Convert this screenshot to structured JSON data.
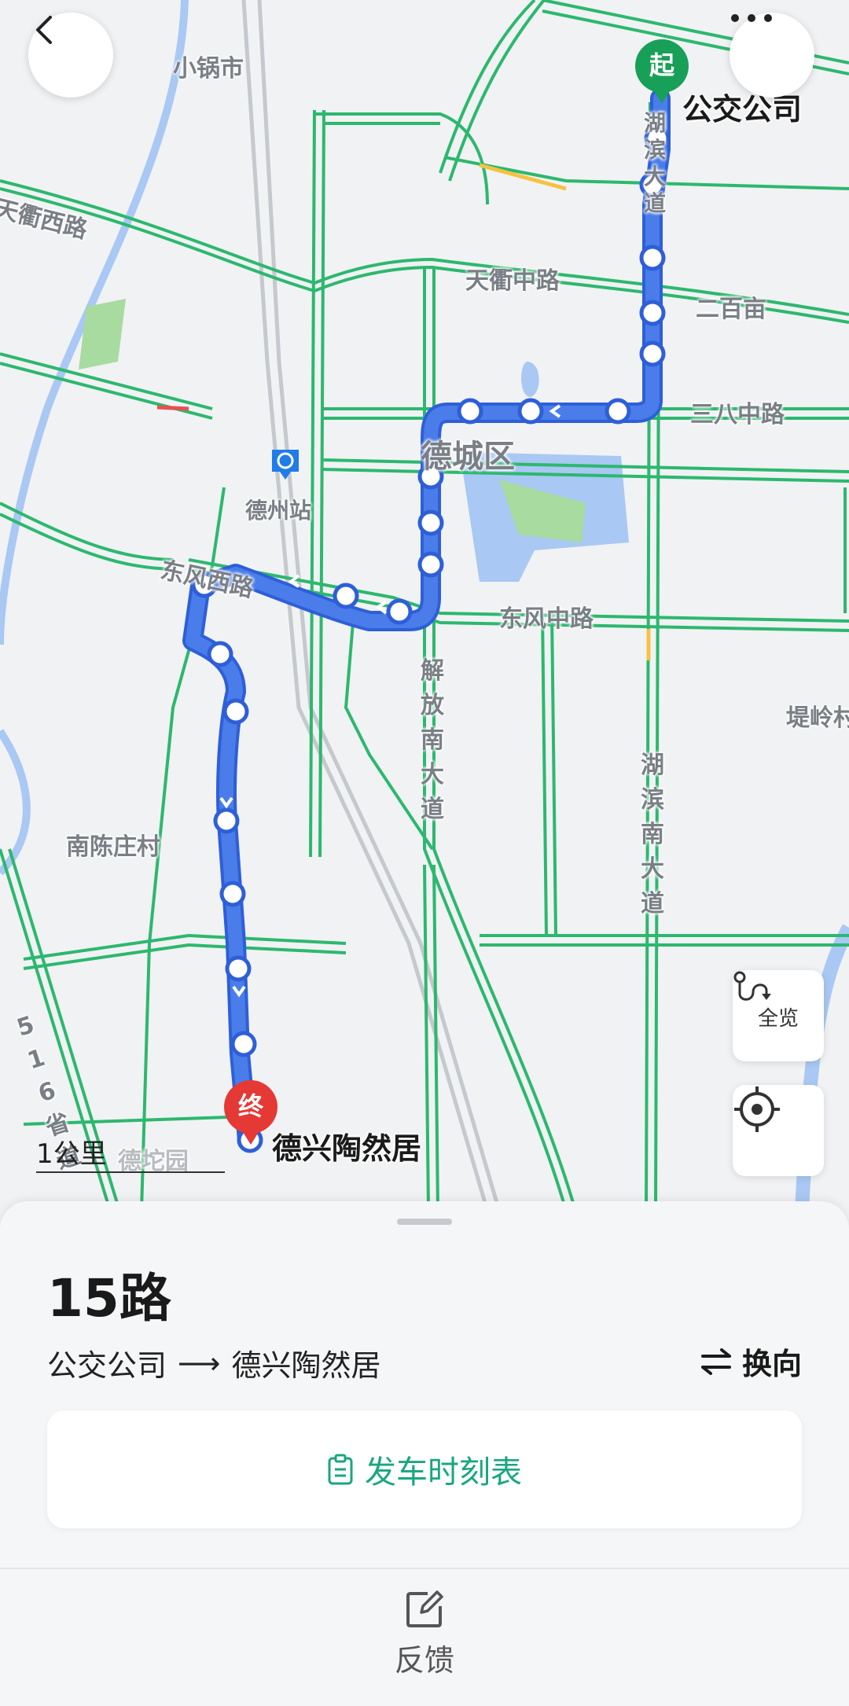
{
  "map": {
    "labels": {
      "xiaoguo": "小锅市",
      "tianqu_west": "天衢西路",
      "tianqu_mid": "天衢中路",
      "erbaimu": "二百亩",
      "sanba_mid": "三八中路",
      "decheng": "德城区",
      "dezhou_station": "德州站",
      "dongfeng_west": "东风西路",
      "dongfeng_mid": "东风中路",
      "jiefang_south": "解放南大道",
      "hubin_south": "湖滨南大道",
      "diling": "堤岭村",
      "nanchen": "南陈庄村",
      "prov_516": "516省道",
      "dedi_faint": "德坨园",
      "hubin_top": "湖滨大道"
    },
    "start_stop": "公交公司",
    "end_stop": "德兴陶然居",
    "start_pin": "起",
    "end_pin": "终",
    "scale_label": "1公里",
    "route_color": "#3d6fe0",
    "road_color": "#2cb86e"
  },
  "controls": {
    "back_icon": "chevron-left-icon",
    "more_icon": "more-dots-icon",
    "overview_label": "全览",
    "locate_icon": "locate-icon"
  },
  "route": {
    "name": "15路",
    "from": "公交公司",
    "arrow": "⟶",
    "to": "德兴陶然居",
    "reverse_label": "换向",
    "schedule_label": "发车时刻表",
    "feedback_label": "反馈"
  }
}
